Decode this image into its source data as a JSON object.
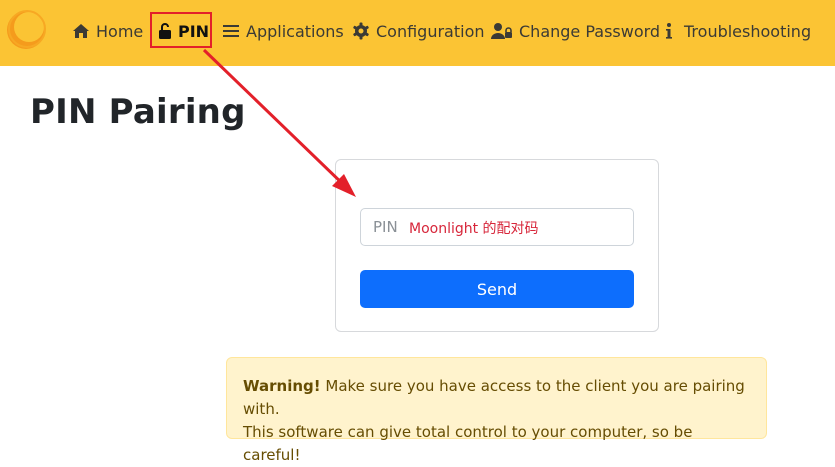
{
  "nav": {
    "items": [
      {
        "label": "Home",
        "icon": "home-icon"
      },
      {
        "label": "PIN",
        "icon": "lock-open-icon",
        "active": true
      },
      {
        "label": "Applications",
        "icon": "menu-lines-icon"
      },
      {
        "label": "Configuration",
        "icon": "gear-icon"
      },
      {
        "label": "Change Password",
        "icon": "user-lock-icon"
      },
      {
        "label": "Troubleshooting",
        "icon": "info-icon"
      }
    ]
  },
  "page": {
    "title": "PIN Pairing"
  },
  "form": {
    "pin_placeholder": "PIN",
    "pin_value": "",
    "annotation": "Moonlight 的配对码",
    "send_label": "Send"
  },
  "alert": {
    "strong": "Warning!",
    "line1": " Make sure you have access to the client you are pairing with.",
    "line2": "This software can give total control to your computer, so be careful!"
  },
  "colors": {
    "navbar": "#fbc434",
    "primary": "#0d6efd",
    "annotation_red": "#e3202a",
    "warning_bg": "#fff3cd"
  }
}
